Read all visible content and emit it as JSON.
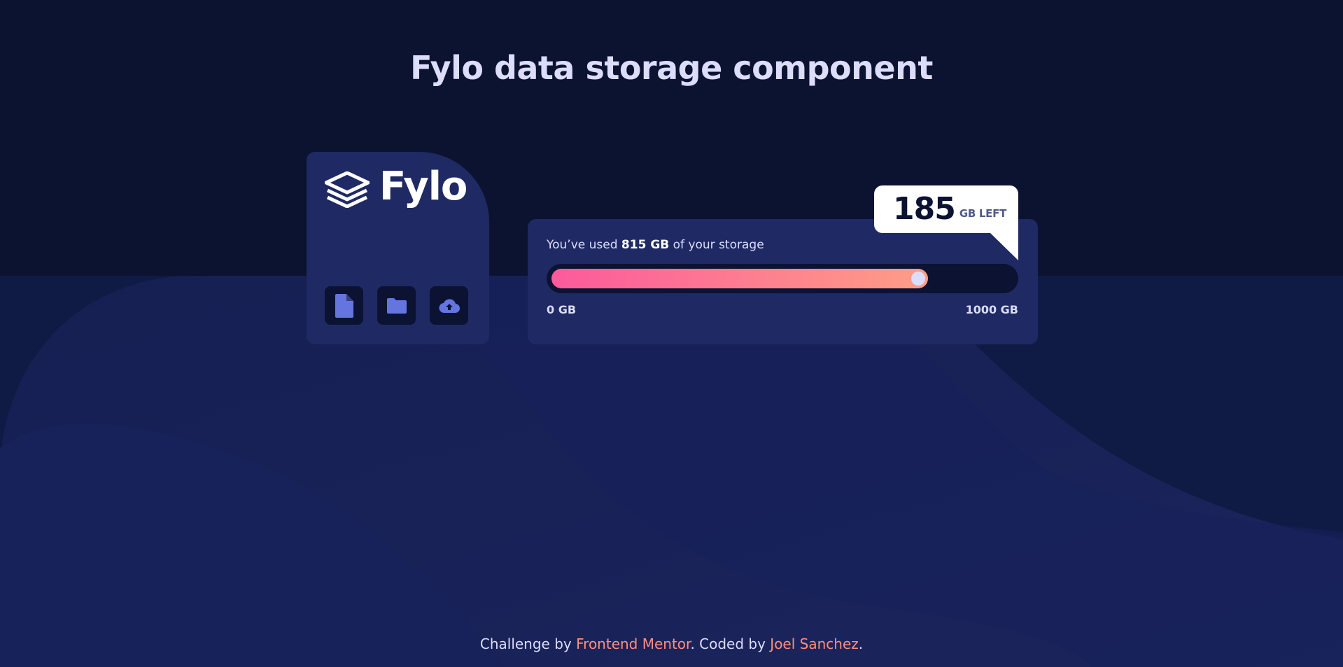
{
  "page": {
    "title": "Fylo data storage component"
  },
  "logo": {
    "text": "Fylo"
  },
  "toolbar": {
    "buttons": [
      {
        "name": "file-icon"
      },
      {
        "name": "folder-icon"
      },
      {
        "name": "upload-icon"
      }
    ]
  },
  "storage": {
    "usage_prefix": "You’ve used ",
    "used_value": "815 GB",
    "usage_suffix": " of your storage",
    "used_fraction": 0.815,
    "range_min": "0 GB",
    "range_max": "1000 GB"
  },
  "callout": {
    "number": "185",
    "unit": "GB LEFT"
  },
  "footer": {
    "prefix": "Challenge by ",
    "mentor_link": "Frontend Mentor",
    "middle": ". Coded by ",
    "author_link": "Joel Sanchez",
    "suffix": "."
  },
  "colors": {
    "background": "#0c1330",
    "card": "#1f2a64",
    "accent_pink": "#fc5a9c",
    "accent_peach": "#fe9e86",
    "link": "#ff8e7f",
    "text_light": "#dcdcfb"
  }
}
